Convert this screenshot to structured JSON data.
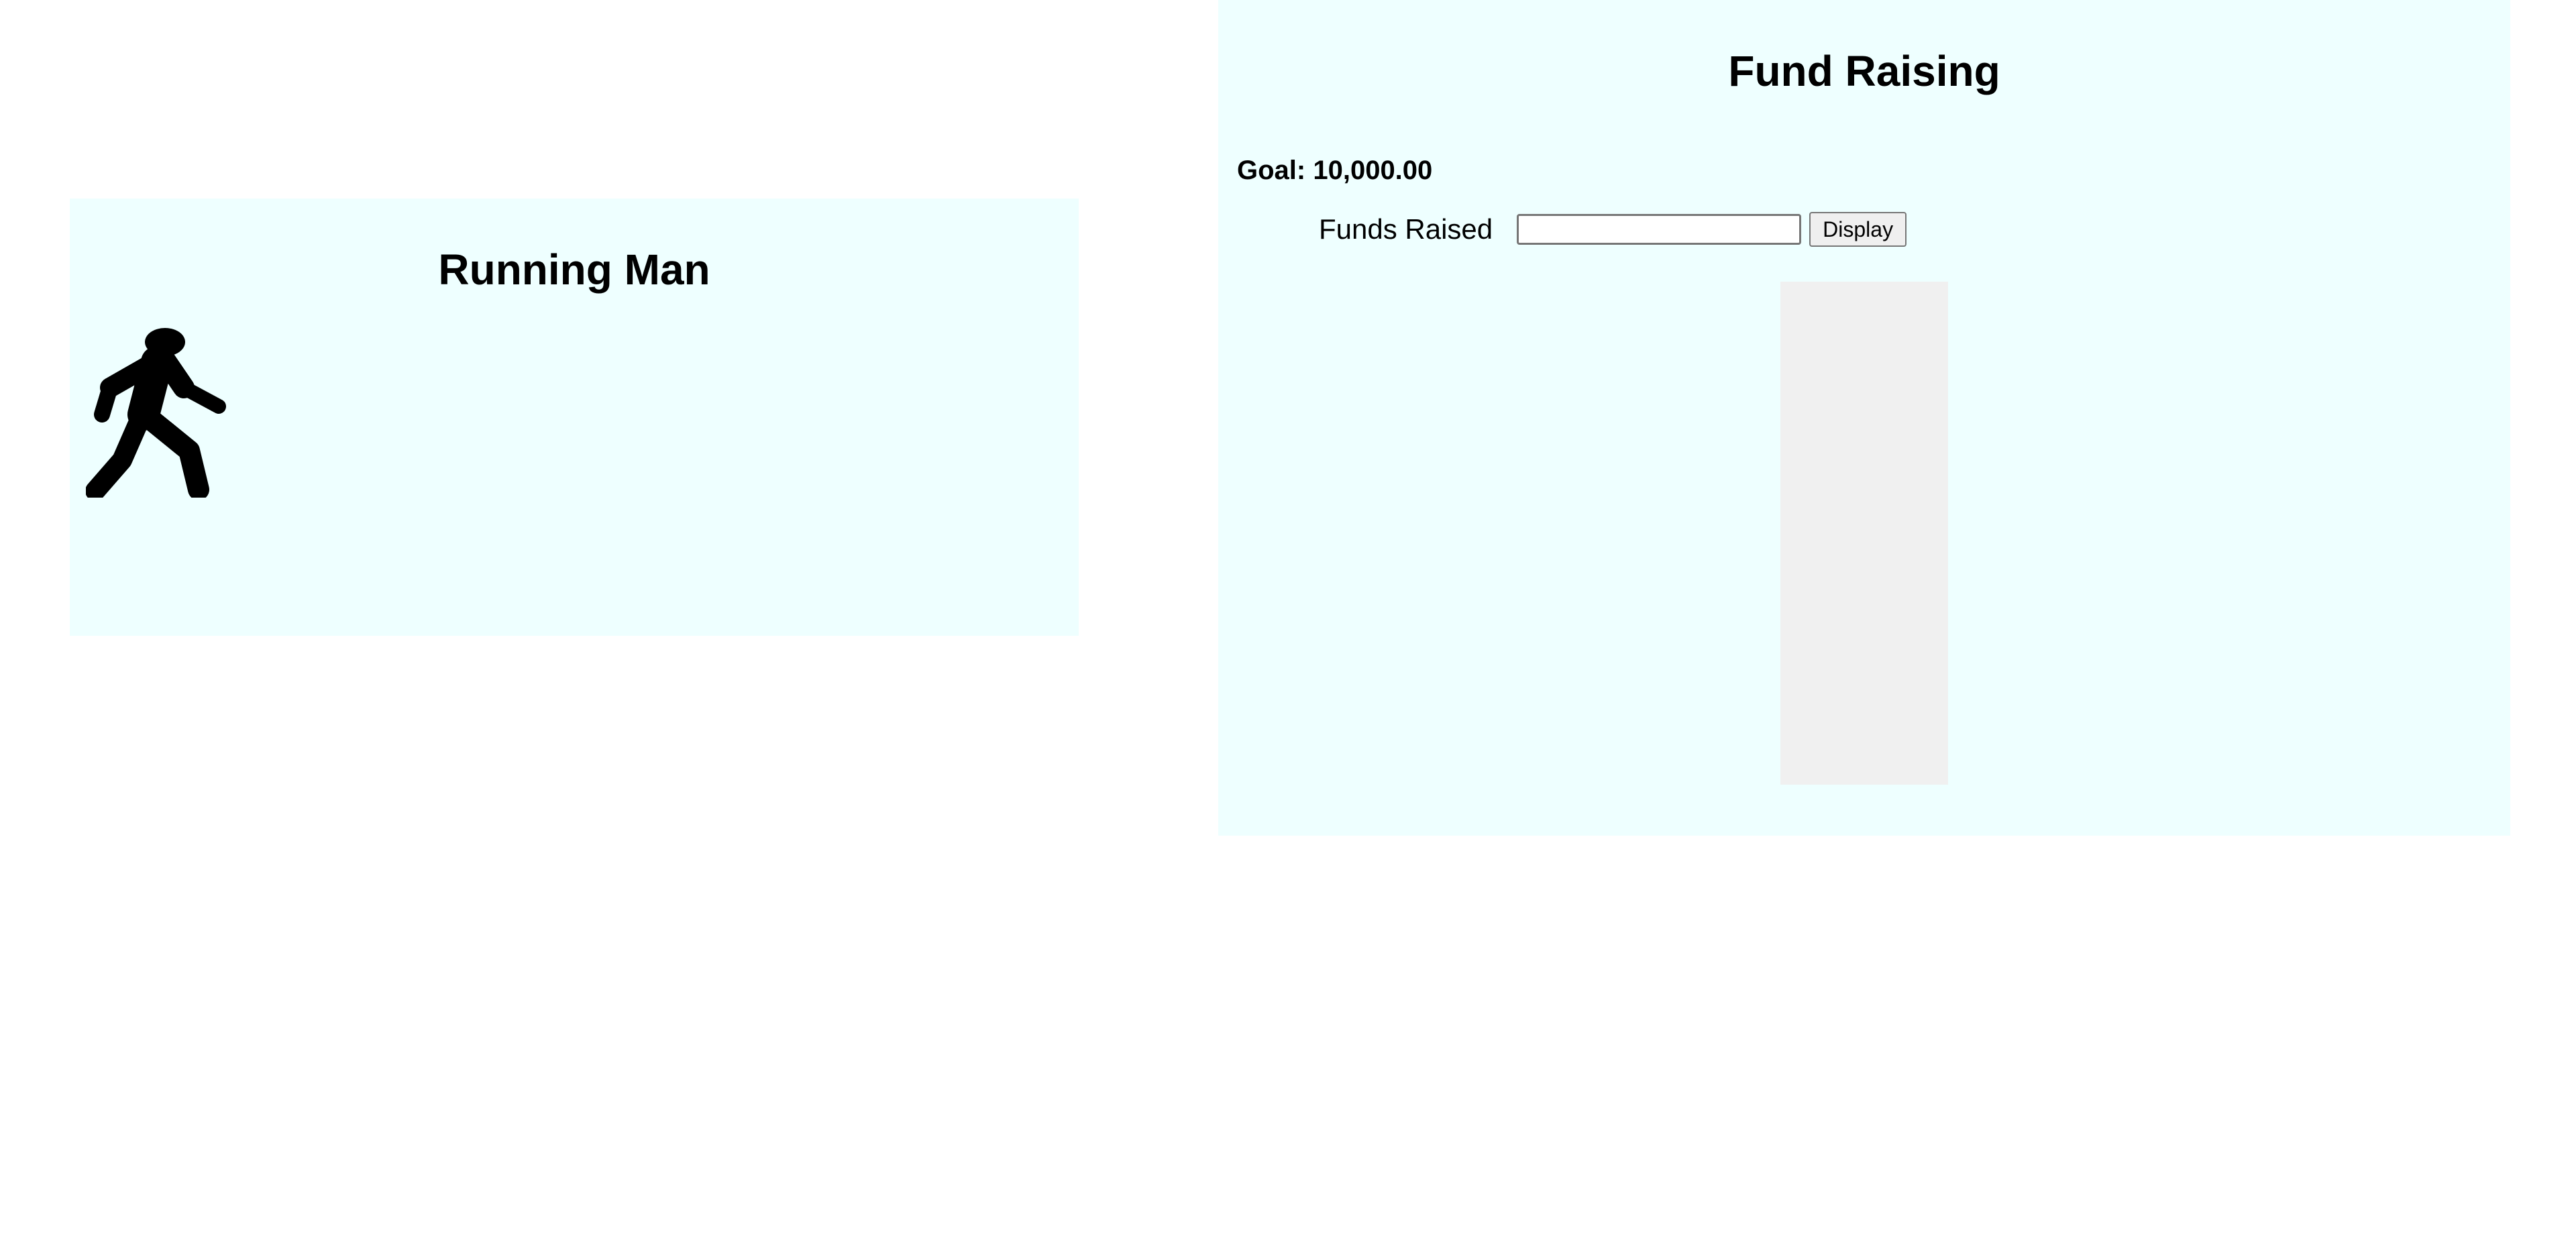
{
  "running_man": {
    "title": "Running Man",
    "icon": "walking-person-icon"
  },
  "fund_raising": {
    "title": "Fund Raising",
    "goal_text": "Goal: 10,000.00",
    "goal_value": 10000,
    "funds_raised_label": "Funds Raised",
    "funds_raised_value": "",
    "funds_raised_fraction": 0,
    "display_button_label": "Display",
    "thermometer_background": "#f0f0f0"
  },
  "colors": {
    "panel_background": "#eeffff",
    "page_background": "#ffffff"
  }
}
